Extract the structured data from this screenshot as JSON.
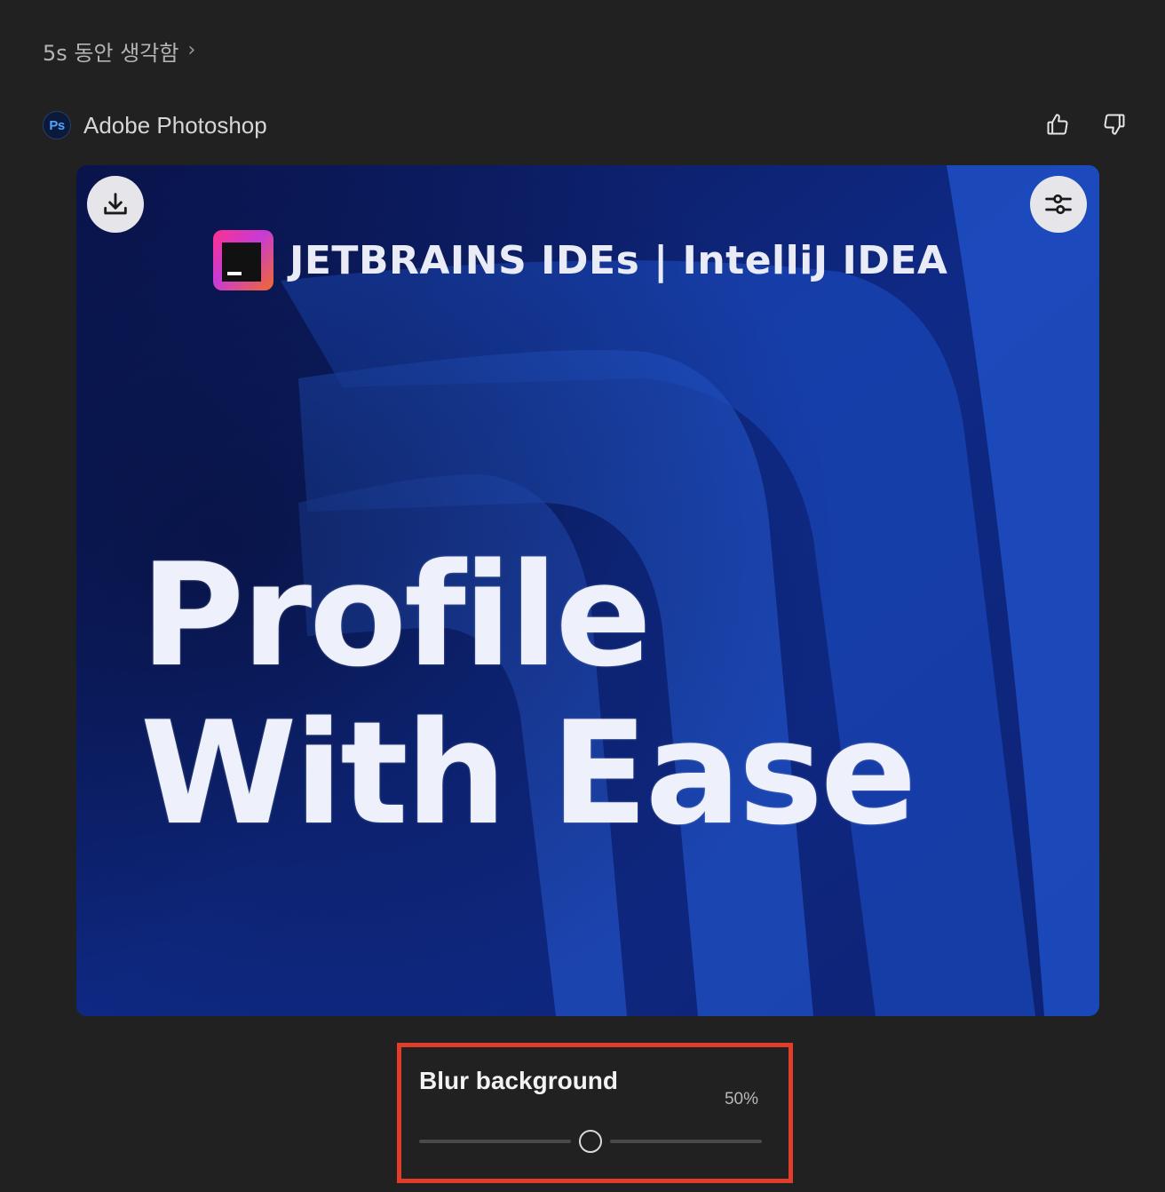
{
  "thinking": {
    "label": "5s 동안 생각함",
    "chevron": "›"
  },
  "tool": {
    "badge": "Ps",
    "name": "Adobe Photoshop"
  },
  "feedback": {
    "icons": [
      "thumbs-up-icon",
      "thumbs-down-icon"
    ]
  },
  "image": {
    "brand": "JETBRAINS IDEs | IntelliJ IDEA",
    "headline": "Profile\nWith Ease",
    "accent_colors": {
      "background": "#0c1f66",
      "logo_pink": "#ff318c",
      "logo_orange": "#f26a2b"
    },
    "buttons": [
      "download-icon",
      "adjustments-icon"
    ]
  },
  "blur": {
    "title": "Blur background",
    "value_label": "50%",
    "value": 0.5,
    "highlight_color": "#e23c2a"
  }
}
